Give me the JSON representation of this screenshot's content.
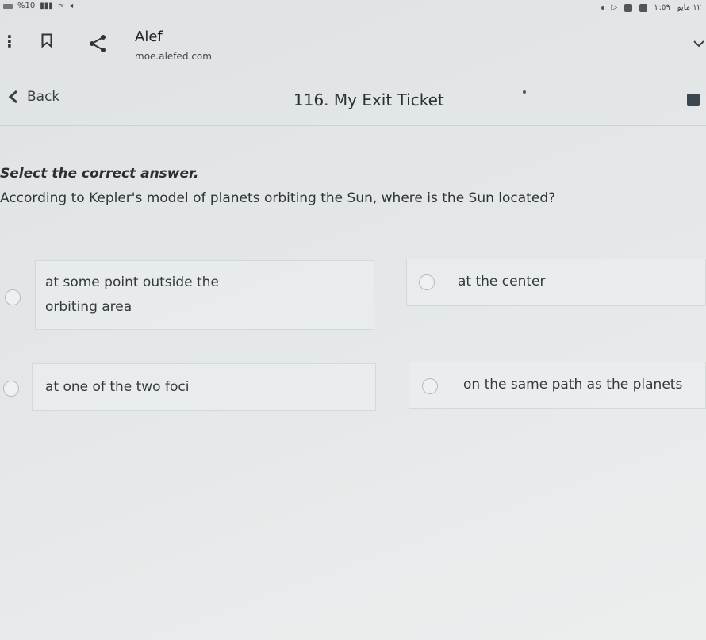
{
  "status_bar": {
    "left_text": "%10",
    "time": "٢:٥٩",
    "date": "١٢ مايو"
  },
  "browser": {
    "site_title": "Alef",
    "site_url": "moe.alefed.com"
  },
  "header": {
    "back_label": "Back",
    "title": "116. My Exit Ticket"
  },
  "quiz": {
    "instruction": "Select the correct answer.",
    "question": "According to Kepler's model of planets orbiting the Sun, where is the Sun located?",
    "options": [
      {
        "line1": "at some point outside the",
        "line2": "orbiting area"
      },
      {
        "label": "at the center"
      },
      {
        "label": "at one of the two foci"
      },
      {
        "label": "on the same path as the planets"
      }
    ]
  }
}
